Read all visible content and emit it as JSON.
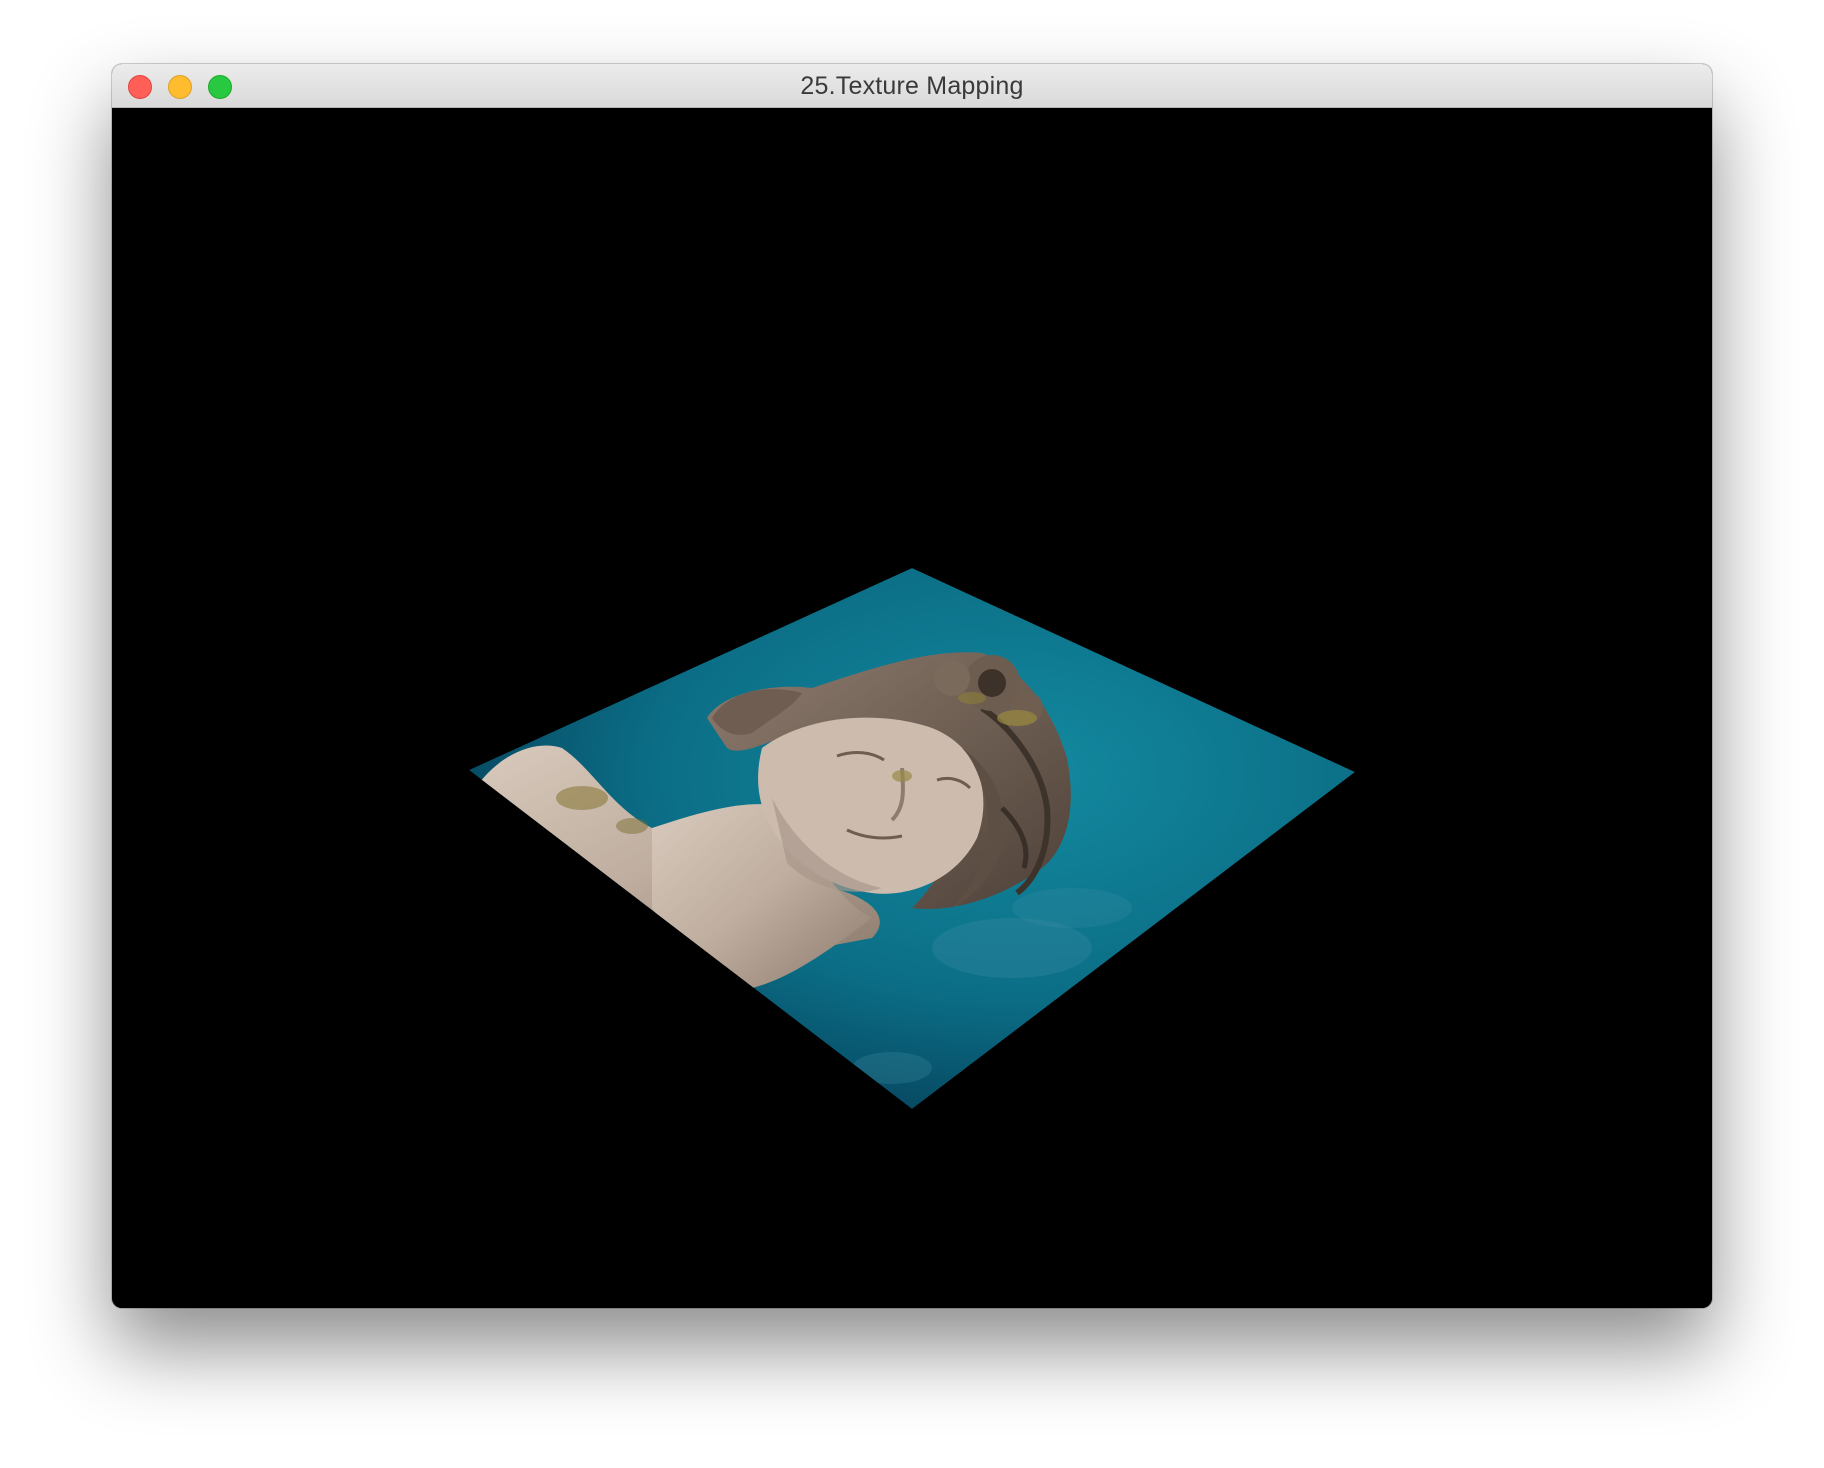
{
  "window": {
    "title": "25.Texture Mapping",
    "controls": {
      "close": "close-button",
      "minimize": "minimize-button",
      "zoom": "zoom-button"
    },
    "colors": {
      "close": "#ff5f57",
      "minimize": "#febc2e",
      "zoom": "#28c840",
      "content_background": "#000000"
    }
  },
  "scene": {
    "subject": "textured quad showing marble statue head against blue sky",
    "sky_color": "#0e7a8e",
    "sky_dark": "#063c52",
    "statue_color": "#c9b7a8"
  }
}
